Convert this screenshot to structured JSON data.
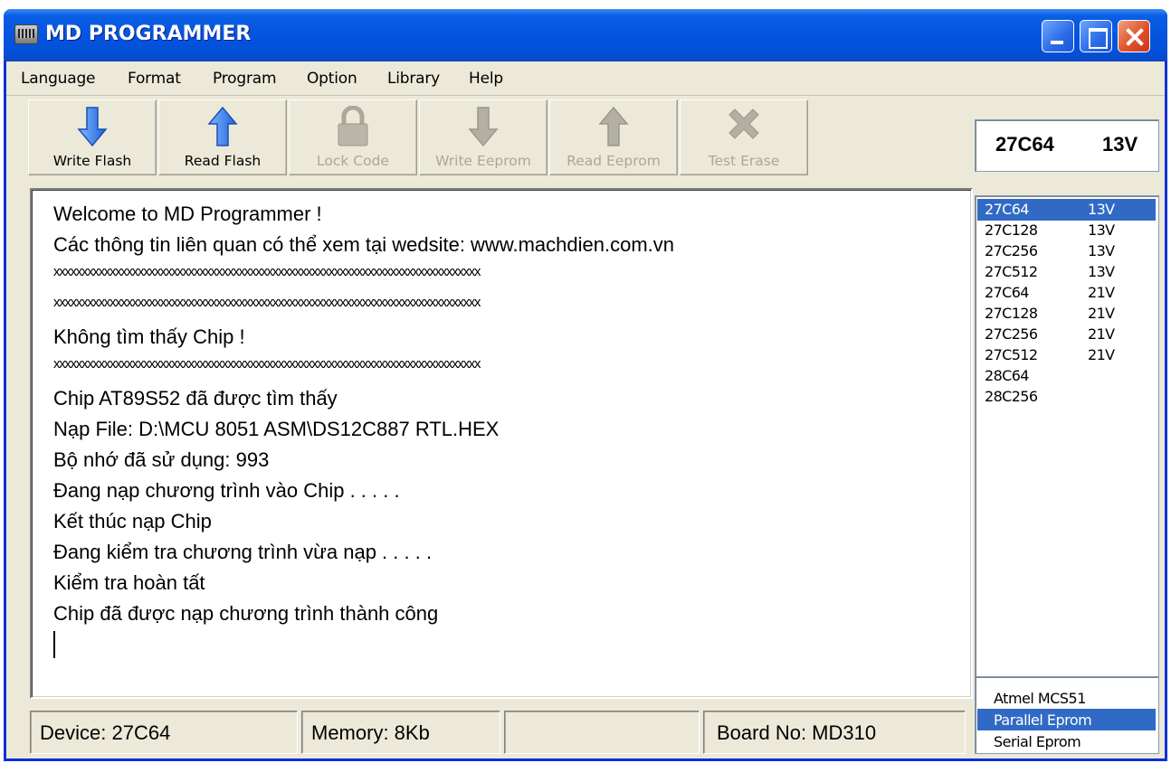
{
  "window": {
    "title": "MD PROGRAMMER"
  },
  "menu": [
    "Language",
    "Format",
    "Program",
    "Option",
    "Library",
    "Help"
  ],
  "toolbar": [
    {
      "label": "Write Flash",
      "icon": "down-arrow-icon",
      "enabled": true
    },
    {
      "label": "Read Flash",
      "icon": "up-arrow-icon",
      "enabled": true
    },
    {
      "label": "Lock Code",
      "icon": "lock-icon",
      "enabled": false
    },
    {
      "label": "Write Eeprom",
      "icon": "down-arrow-icon",
      "enabled": false
    },
    {
      "label": "Read Eeprom",
      "icon": "up-arrow-icon",
      "enabled": false
    },
    {
      "label": "Test Erase",
      "icon": "x-icon",
      "enabled": false
    }
  ],
  "chip": {
    "name": "27C64",
    "voltage": "13V"
  },
  "log": [
    "Welcome to MD Programmer !",
    "Các thông tin liên quan có thể xem tại wedsite: www.machdien.com.vn",
    "xxxxxxxxxxxxxxxxxxxxxxxxxxxxxxxxxxxxxxxxxxxxxxxxxxxxxxxxxxxxxxxxxxxxxxxxxxxx",
    "xxxxxxxxxxxxxxxxxxxxxxxxxxxxxxxxxxxxxxxxxxxxxxxxxxxxxxxxxxxxxxxxxxxxxxxxxxxx",
    "Không tìm thấy Chip !",
    "xxxxxxxxxxxxxxxxxxxxxxxxxxxxxxxxxxxxxxxxxxxxxxxxxxxxxxxxxxxxxxxxxxxxxxxxxxxx",
    "Chip AT89S52 đã được tìm thấy",
    "Nạp File: D:\\MCU 8051 ASM\\DS12C887 RTL.HEX",
    "Bộ nhớ đã sử dụng: 993",
    "Đang nạp chương trình vào Chip . . . . .",
    "Kết thúc nạp Chip",
    "Đang kiểm tra chương trình vừa nạp . . . . .",
    "Kiểm tra hoàn tất",
    "Chip đã được nạp chương trình thành công"
  ],
  "devices": [
    {
      "name": "27C64",
      "voltage": "13V",
      "selected": true
    },
    {
      "name": "27C128",
      "voltage": "13V"
    },
    {
      "name": "27C256",
      "voltage": "13V"
    },
    {
      "name": "27C512",
      "voltage": "13V"
    },
    {
      "name": "27C64",
      "voltage": "21V"
    },
    {
      "name": "27C128",
      "voltage": "21V"
    },
    {
      "name": "27C256",
      "voltage": "21V"
    },
    {
      "name": "27C512",
      "voltage": "21V"
    },
    {
      "name": "28C64",
      "voltage": ""
    },
    {
      "name": "28C256",
      "voltage": ""
    }
  ],
  "families": [
    {
      "name": "Atmel MCS51"
    },
    {
      "name": "Parallel Eprom",
      "selected": true
    },
    {
      "name": "Serial Eprom"
    }
  ],
  "status": {
    "device": "Device:  27C64",
    "memory": "Memory: 8Kb",
    "blank": "",
    "board": "Board No: MD310"
  },
  "colors": {
    "titlebar": "#0554e0",
    "selection": "#316ac5",
    "arrow_enabled": "#2f7fe0",
    "icon_disabled": "#aca899"
  }
}
